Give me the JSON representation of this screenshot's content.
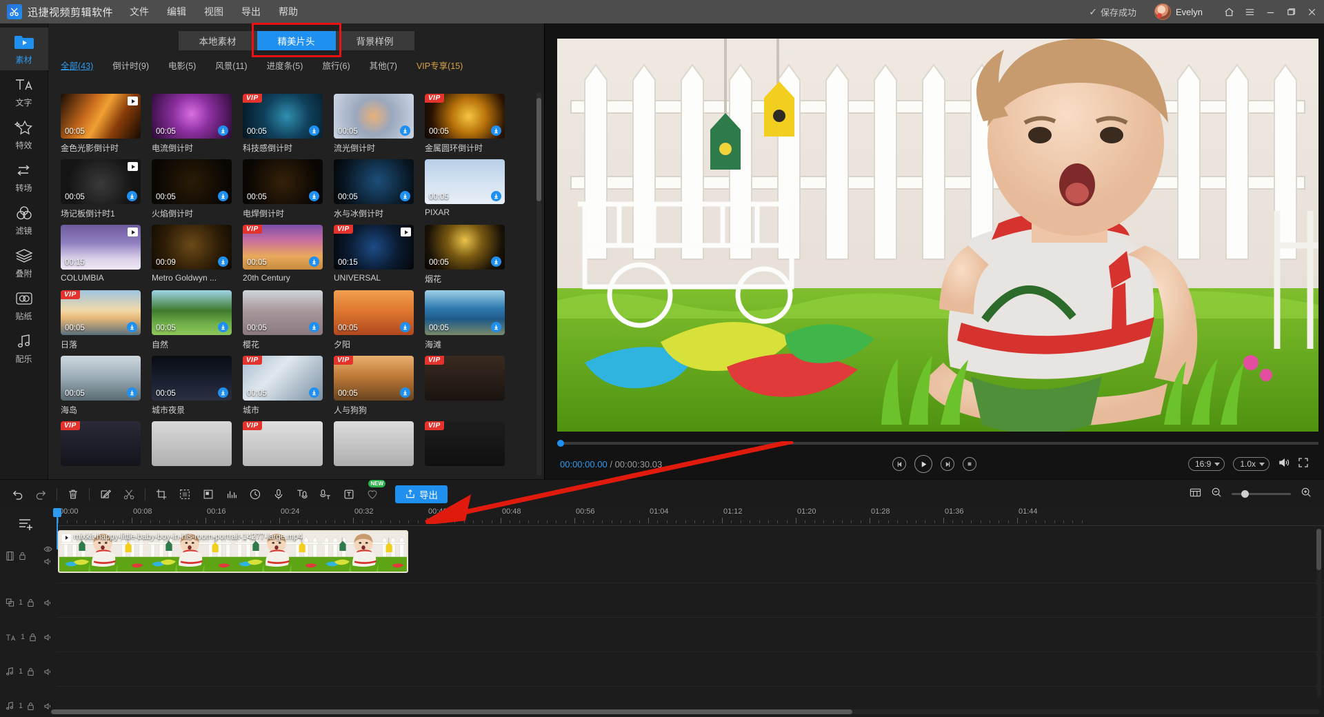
{
  "titlebar": {
    "app_name": "迅捷视频剪辑软件",
    "menus": [
      "文件",
      "编辑",
      "视图",
      "导出",
      "帮助"
    ],
    "save_status": "保存成功",
    "save_check_icon": "check-icon",
    "user_name": "Evelyn",
    "home_icon": "home-icon",
    "menu_icon": "hamburger-menu-icon",
    "minimize_icon": "minimize-icon",
    "maximize_icon": "maximize-icon",
    "close_icon": "close-icon",
    "bg_color": "#4d4d4d"
  },
  "rail": {
    "items": [
      {
        "label": "素材",
        "icon": "folder-video-icon",
        "active": true
      },
      {
        "label": "文字",
        "icon": "text-icon",
        "active": false
      },
      {
        "label": "特效",
        "icon": "sparkle-star-icon",
        "active": false
      },
      {
        "label": "转场",
        "icon": "transition-loop-icon",
        "active": false
      },
      {
        "label": "滤镜",
        "icon": "filter-circles-icon",
        "active": false
      },
      {
        "label": "叠附",
        "icon": "layers-icon",
        "active": false
      },
      {
        "label": "贴纸",
        "icon": "sticker-icon",
        "active": false
      },
      {
        "label": "配乐",
        "icon": "music-note-icon",
        "active": false
      }
    ],
    "active_color": "#2e9bf0"
  },
  "panel": {
    "tabs": [
      {
        "label": "本地素材",
        "active": false,
        "highlighted": false
      },
      {
        "label": "精美片头",
        "active": true,
        "highlighted": true
      },
      {
        "label": "背景样例",
        "active": false,
        "highlighted": false
      }
    ],
    "highlight_color": "#ee1111",
    "accent_color": "#1f8ff0",
    "categories": [
      {
        "label": "全部(43)",
        "active": true,
        "vip": false
      },
      {
        "label": "倒计时(9)",
        "active": false,
        "vip": false
      },
      {
        "label": "电影(5)",
        "active": false,
        "vip": false
      },
      {
        "label": "风景(11)",
        "active": false,
        "vip": false
      },
      {
        "label": "进度条(5)",
        "active": false,
        "vip": false
      },
      {
        "label": "旅行(6)",
        "active": false,
        "vip": false
      },
      {
        "label": "其他(7)",
        "active": false,
        "vip": false
      },
      {
        "label": "VIP专享(15)",
        "active": false,
        "vip": true
      }
    ],
    "vip_badge_text": "VIP",
    "items": [
      {
        "label": "金色光影倒计时",
        "duration": "00:05",
        "vip": false,
        "download": false,
        "play": true,
        "style": "linear-gradient(120deg,#1a0d05 0%,#c86a1c 35%,#f0a033 50%,#8a3d08 70%,#140a04 100%)"
      },
      {
        "label": "电流倒计时",
        "duration": "00:05",
        "vip": false,
        "download": true,
        "play": false,
        "style": "radial-gradient(circle at 50% 45%,#d86fe0 0%,#8b2f9e 40%,#2a0a35 100%)"
      },
      {
        "label": "科技感倒计时",
        "duration": "00:05",
        "vip": true,
        "download": true,
        "play": false,
        "style": "radial-gradient(circle at 55% 50%,#2f8fb0 0%,#10415c 45%,#04141f 100%)"
      },
      {
        "label": "流光倒计时",
        "duration": "00:05",
        "vip": false,
        "download": true,
        "play": false,
        "style": "radial-gradient(circle at 50% 50%,#e8b07a 0%,#9aa7bd 40%,#cdd6e4 100%)"
      },
      {
        "label": "金属圆环倒计时",
        "duration": "00:05",
        "vip": true,
        "download": true,
        "play": false,
        "style": "radial-gradient(circle at 55% 50%,#f5c542 0%,#b8720a 35%,#2a1403 75%,#0b0703 100%)"
      },
      {
        "label": "场记板倒计时1",
        "duration": "00:05",
        "vip": false,
        "download": true,
        "play": true,
        "style": "radial-gradient(circle at 50% 55%,#3a3a3a 0%,#141414 70%)"
      },
      {
        "label": "火焰倒计时",
        "duration": "00:05",
        "vip": false,
        "download": true,
        "play": false,
        "style": "radial-gradient(circle at 50% 50%,#2a1b06 0%,#0a0703 80%)"
      },
      {
        "label": "电焊倒计时",
        "duration": "00:05",
        "vip": false,
        "download": true,
        "play": false,
        "style": "radial-gradient(circle at 50% 50%,#35210a 0%,#090603 80%)"
      },
      {
        "label": "水与冰倒计时",
        "duration": "00:05",
        "vip": false,
        "download": true,
        "play": false,
        "style": "radial-gradient(circle at 55% 48%,#1d4f7a 0%,#07141f 70%,#050505 100%)"
      },
      {
        "label": "PIXAR",
        "duration": "00:05",
        "vip": false,
        "download": true,
        "play": false,
        "style": "linear-gradient(180deg,#b8cfe8 0%,#d7e4f2 60%,#e9eff6 100%)"
      },
      {
        "label": "COLUMBIA",
        "duration": "00:15",
        "vip": false,
        "download": false,
        "play": true,
        "style": "linear-gradient(180deg,#6e5b9e 0%,#8f7ec0 40%,#d9cfe8 75%,#f0e8f5 100%)"
      },
      {
        "label": "Metro Goldwyn ...",
        "duration": "00:09",
        "vip": false,
        "download": true,
        "play": false,
        "style": "radial-gradient(circle at 50% 45%,#6b4a18 0%,#2d1c06 60%,#100a03 100%)"
      },
      {
        "label": "20th Century",
        "duration": "00:05",
        "vip": true,
        "download": true,
        "play": false,
        "style": "linear-gradient(180deg,#7b4fa8 0%,#c96fa0 35%,#e8a95c 70%,#c88a3c 100%)"
      },
      {
        "label": "UNIVERSAL",
        "duration": "00:15",
        "vip": true,
        "download": false,
        "play": true,
        "style": "radial-gradient(circle at 50% 50%,#1d4c86 0%,#0a1a30 55%,#040609 100%)"
      },
      {
        "label": "烟花",
        "duration": "00:05",
        "vip": false,
        "download": true,
        "play": false,
        "style": "radial-gradient(circle at 50% 35%,#e8c24a 0%,#7a5a12 35%,#1a1206 75%,#080603 100%)"
      },
      {
        "label": "日落",
        "duration": "00:05",
        "vip": true,
        "download": true,
        "play": false,
        "style": "linear-gradient(180deg,#9fc4e0 0%,#f2d9a8 45%,#e8b878 62%,#5a6f7a 100%)"
      },
      {
        "label": "自然",
        "duration": "00:05",
        "vip": false,
        "download": true,
        "play": false,
        "style": "linear-gradient(180deg,#9fd4e8 0%,#3e7a2e 45%,#6fb04a 75%,#8fc85a 100%)"
      },
      {
        "label": "樱花",
        "duration": "00:05",
        "vip": false,
        "download": true,
        "play": false,
        "style": "linear-gradient(180deg,#cfd6dc 0%,#a8989c 45%,#8a7a80 100%)"
      },
      {
        "label": "夕阳",
        "duration": "00:05",
        "vip": false,
        "download": true,
        "play": false,
        "style": "linear-gradient(180deg,#f0a050 0%,#e07830 45%,#b04820 100%)"
      },
      {
        "label": "海滩",
        "duration": "00:05",
        "vip": false,
        "download": true,
        "play": false,
        "style": "linear-gradient(180deg,#9fd0e8 0%,#2f7ab0 40%,#1f5a88 65%,#7a8a6a 100%)"
      },
      {
        "label": "海岛",
        "duration": "00:05",
        "vip": false,
        "download": true,
        "play": false,
        "style": "linear-gradient(180deg,#cfd8de 0%,#9fb0bc 45%,#5a6a70 100%)"
      },
      {
        "label": "城市夜景",
        "duration": "00:05",
        "vip": false,
        "download": true,
        "play": false,
        "style": "linear-gradient(180deg,#0a0c12 0%,#1a2030 55%,#2a3040 100%)"
      },
      {
        "label": "城市",
        "duration": "00:05",
        "vip": true,
        "download": true,
        "play": false,
        "style": "linear-gradient(135deg,#a8bcd0 0%,#e0e8ee 40%,#7a90a4 100%)"
      },
      {
        "label": "人与狗狗",
        "duration": "00:05",
        "vip": true,
        "download": true,
        "play": false,
        "style": "linear-gradient(180deg,#e8b070 0%,#c07a38 45%,#6a4420 100%)"
      },
      {
        "label": "",
        "duration": "",
        "vip": true,
        "download": false,
        "play": false,
        "style": "linear-gradient(180deg,#3a2a20 0%,#1a1410 100%)"
      },
      {
        "label": "",
        "duration": "",
        "vip": true,
        "download": false,
        "play": false,
        "style": "linear-gradient(180deg,#2a2a38 0%,#14141c 100%)"
      },
      {
        "label": "",
        "duration": "",
        "vip": false,
        "download": false,
        "play": false,
        "style": "linear-gradient(180deg,#d8d8d8 0%,#b0b0b0 100%)"
      },
      {
        "label": "",
        "duration": "",
        "vip": true,
        "download": false,
        "play": false,
        "style": "linear-gradient(180deg,#e0e0e0 0%,#b8b8b8 100%)"
      },
      {
        "label": "",
        "duration": "",
        "vip": false,
        "download": false,
        "play": false,
        "style": "linear-gradient(180deg,#dcdcdc 0%,#aeaeae 100%)"
      },
      {
        "label": "",
        "duration": "",
        "vip": true,
        "download": false,
        "play": false,
        "style": "linear-gradient(180deg,#1e1e1e 0%,#101010 100%)"
      }
    ]
  },
  "preview": {
    "current_time": "00:00:00.00",
    "separator": "/",
    "total_time": "00:00:30.03",
    "controls": {
      "prev_frame_icon": "step-backward-icon",
      "play_icon": "play-icon",
      "next_frame_icon": "step-forward-icon",
      "stop_icon": "stop-icon"
    },
    "aspect_ratio": "16:9",
    "speed": "1.0x",
    "volume_icon": "volume-icon",
    "fullscreen_icon": "fullscreen-icon"
  },
  "toolbar": {
    "buttons": [
      {
        "name": "undo-button",
        "icon": "undo-icon"
      },
      {
        "name": "redo-button",
        "icon": "redo-icon"
      },
      {
        "name": "delete-button",
        "icon": "trash-icon"
      },
      {
        "name": "edit-button",
        "icon": "pencil-square-icon"
      },
      {
        "name": "cut-button",
        "icon": "scissors-icon"
      },
      {
        "name": "crop-button",
        "icon": "crop-icon"
      },
      {
        "name": "mosaic-button",
        "icon": "mosaic-icon"
      },
      {
        "name": "watermark-button",
        "icon": "watermark-icon"
      },
      {
        "name": "audio-wave-button",
        "icon": "audio-bars-icon"
      },
      {
        "name": "speed-button",
        "icon": "clock-icon"
      },
      {
        "name": "record-button",
        "icon": "microphone-icon"
      },
      {
        "name": "voice-to-text-button",
        "icon": "voice-text-icon"
      },
      {
        "name": "text-to-voice-button",
        "icon": "text-voice-icon"
      },
      {
        "name": "subtitle-button",
        "icon": "subtitle-icon"
      },
      {
        "name": "favorite-button",
        "icon": "heart-icon",
        "tag": "NEW"
      }
    ],
    "new_tag": "NEW",
    "export_label": "导出",
    "export_icon": "export-icon",
    "export_color": "#1f8ff0",
    "right_tools": {
      "fit_icon": "fit-timeline-icon",
      "zoom_out_icon": "zoom-out-icon",
      "zoom_in_icon": "zoom-in-icon",
      "slider_value": 18
    }
  },
  "timeline": {
    "add_track_icon": "add-track-icon",
    "ruler_labels": [
      "00:00",
      "00:08",
      "00:16",
      "00:24",
      "00:32",
      "00:40",
      "00:48",
      "00:56",
      "01:04",
      "01:12",
      "01:20",
      "01:28",
      "01:36",
      "01:44"
    ],
    "playhead_position": "00:00",
    "clip": {
      "title": "mixkit-happy-little-baby-boy-in-his-room-portrait-14277-large.mp4",
      "icon": "video-clip-icon"
    },
    "tracks": [
      {
        "name": "video-track",
        "icon": "video-track-icon",
        "eye_icon": "eye-icon",
        "lock_icon": "lock-icon",
        "mute_icon": "speaker-icon",
        "label": ""
      },
      {
        "name": "overlay-track",
        "icon": "overlay-track-icon",
        "lock_icon": "lock-icon",
        "mute_icon": "speaker-icon",
        "label": "1"
      },
      {
        "name": "text-track",
        "icon": "text-track-icon",
        "lock_icon": "lock-icon",
        "mute_icon": "speaker-icon",
        "label": "1"
      },
      {
        "name": "music-track",
        "icon": "music-track-icon",
        "lock_icon": "lock-icon",
        "mute_icon": "speaker-icon",
        "label": "1"
      },
      {
        "name": "audio-track",
        "icon": "audio-track-icon",
        "lock_icon": "lock-icon",
        "mute_icon": "speaker-icon",
        "label": "1"
      }
    ]
  },
  "annotation": {
    "arrow_color": "#e01b0e",
    "description": "red-arrow-pointing-to-timeline-clip"
  }
}
